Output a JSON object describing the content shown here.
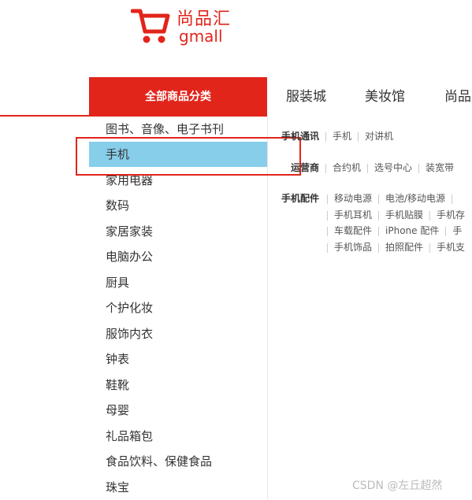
{
  "brand": {
    "name": "尚品汇",
    "sub": "gmall"
  },
  "colors": {
    "accent": "#e1251b",
    "active_bg": "#87ceeb",
    "highlight": "#e1251b"
  },
  "category_header": "全部商品分类",
  "nav": [
    "服装城",
    "美妆馆",
    "尚品"
  ],
  "categories": [
    "图书、音像、电子书刊",
    "手机",
    "家用电器",
    "数码",
    "家居家装",
    "电脑办公",
    "厨具",
    "个护化妆",
    "服饰内衣",
    "钟表",
    "鞋靴",
    "母婴",
    "礼品箱包",
    "食品饮料、保健食品",
    "珠宝"
  ],
  "active_category": "手机",
  "subcategories": {
    "row1": {
      "title": "手机通讯",
      "links": [
        "手机",
        "对讲机"
      ]
    },
    "row2": {
      "title": "运营商",
      "links": [
        "合约机",
        "选号中心",
        "装宽带"
      ]
    },
    "row3": {
      "title": "手机配件",
      "lines": [
        [
          "移动电源",
          "电池/移动电源"
        ],
        [
          "手机耳机",
          "手机贴膜",
          "手机存"
        ],
        [
          "车载配件",
          "iPhone 配件",
          "手"
        ],
        [
          "手机饰品",
          "拍照配件",
          "手机支"
        ]
      ]
    }
  },
  "watermark": "CSDN @左丘超然"
}
